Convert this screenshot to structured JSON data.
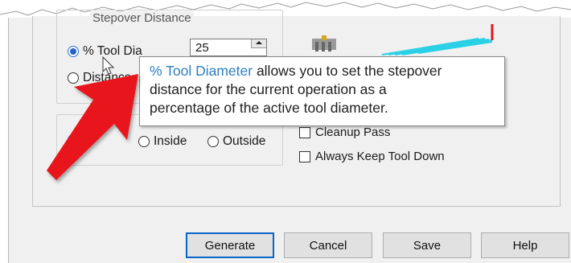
{
  "stepover_group": {
    "legend": "Stepover Distance",
    "pct_tool_dia_label": "% Tool Dia",
    "distance_label": "Distance",
    "value": "25"
  },
  "cut_group": {
    "inside_label": "Inside",
    "outside_label": "Outside"
  },
  "options": {
    "cleanup_pass_label": "Cleanup Pass",
    "always_keep_tool_down_label": "Always Keep Tool Down"
  },
  "tooltip": {
    "highlight": "% Tool Diameter",
    "text_line1_rest": " allows you to set the stepover",
    "text_line2": "distance for the current operation as a",
    "text_line3": "percentage of the active tool diameter."
  },
  "buttons": {
    "generate": "Generate",
    "cancel": "Cancel",
    "save": "Save",
    "help": "Help"
  },
  "colors": {
    "accent": "#2e7fc1",
    "arrow": "#e8141b",
    "preview_lines": "#2ad0e6"
  }
}
